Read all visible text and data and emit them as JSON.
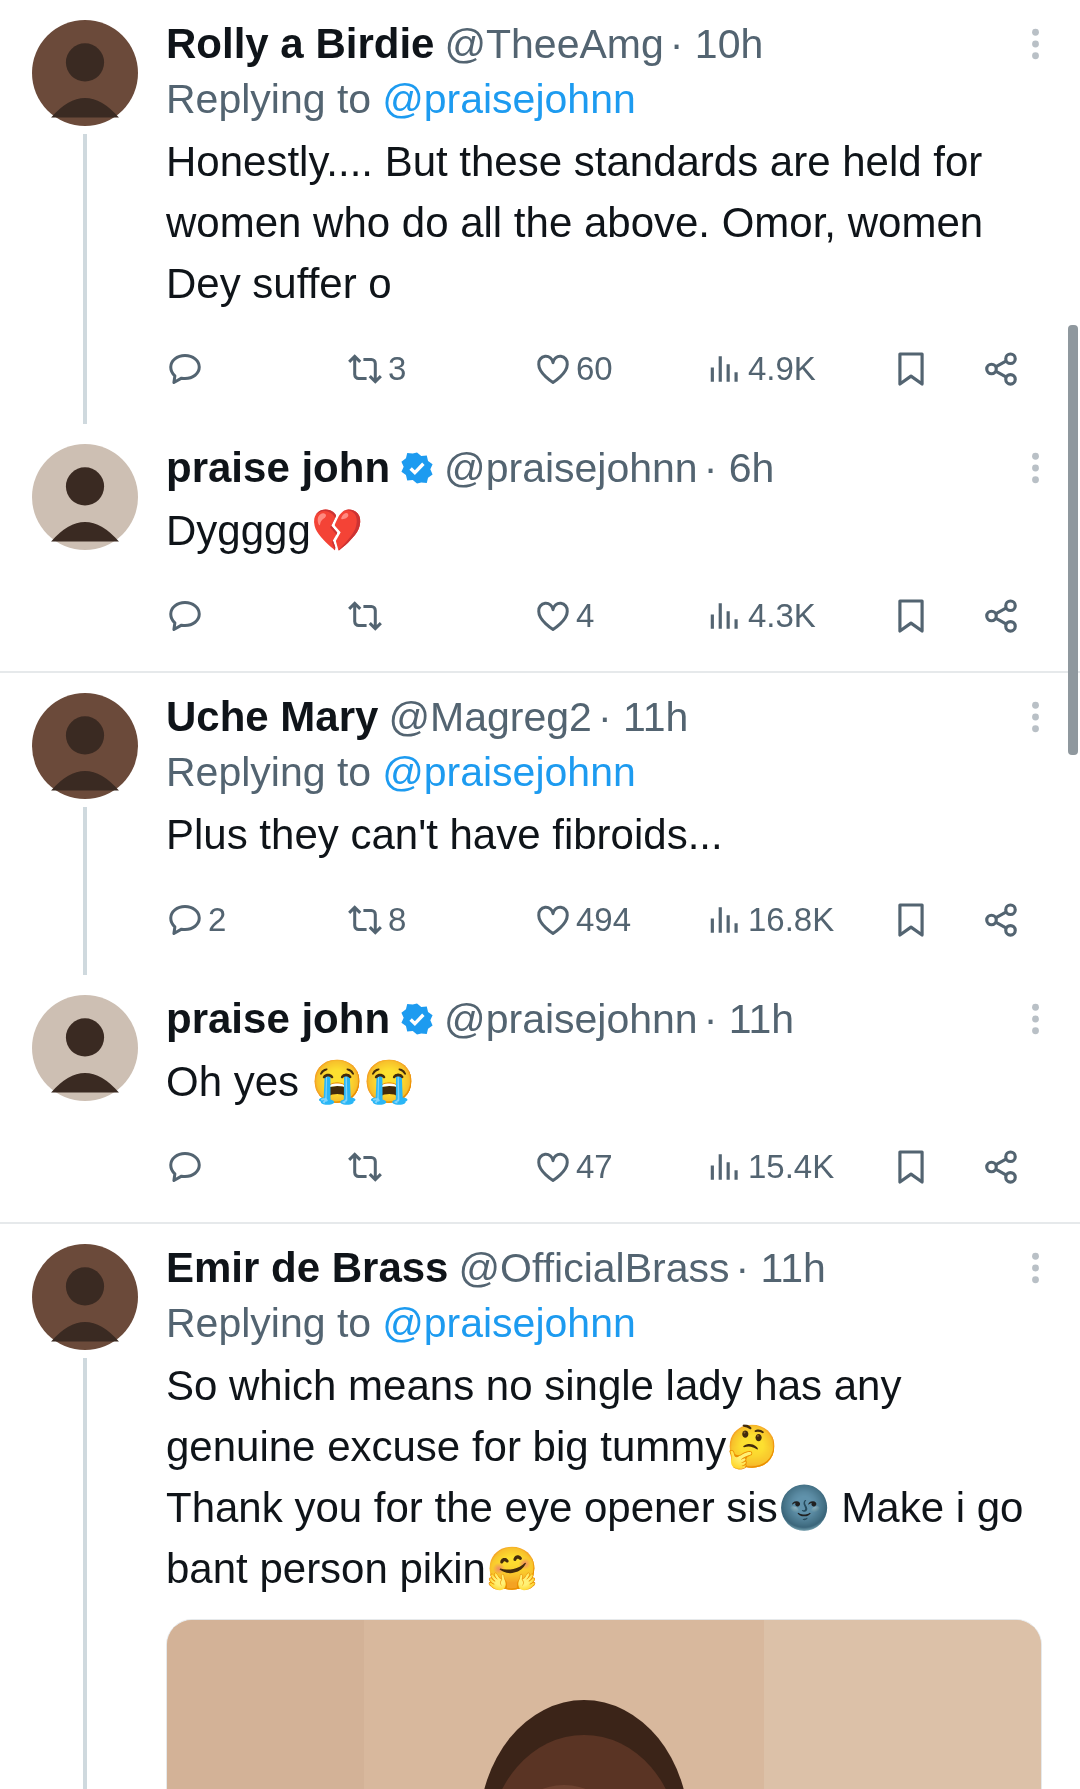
{
  "conversations": [
    {
      "tweets": [
        {
          "name": "Rolly a Birdie",
          "verified": false,
          "handle": "@TheeAmg",
          "time": "· 10h",
          "replying_label": "Replying to",
          "replying_to": "@praisejohnn",
          "text": "Honestly.... But these standards are held for women who do all the above. Omor, women Dey suffer o",
          "thread_line": true,
          "counts": {
            "retweets": "3",
            "likes": "60",
            "views": "4.9K"
          }
        },
        {
          "name": "praise john",
          "verified": true,
          "handle": "@praisejohnn",
          "time": "· 6h",
          "text": "Dygggg💔",
          "thread_line": false,
          "counts": {
            "likes": "4",
            "views": "4.3K"
          }
        }
      ]
    },
    {
      "tweets": [
        {
          "name": "Uche Mary",
          "verified": false,
          "handle": "@Magreg2",
          "time": "· 11h",
          "replying_label": "Replying to",
          "replying_to": "@praisejohnn",
          "text": "Plus they can't have fibroids...",
          "thread_line": true,
          "counts": {
            "replies": "2",
            "retweets": "8",
            "likes": "494",
            "views": "16.8K"
          }
        },
        {
          "name": "praise john",
          "verified": true,
          "handle": "@praisejohnn",
          "time": "· 11h",
          "text": "Oh yes 😭😭",
          "thread_line": false,
          "counts": {
            "likes": "47",
            "views": "15.4K"
          }
        }
      ]
    },
    {
      "tweets": [
        {
          "name": "Emir de Brass",
          "verified": false,
          "handle": "@OfficialBrass",
          "time": "· 11h",
          "replying_label": "Replying to",
          "replying_to": "@praisejohnn",
          "text": "So which means no single lady has any genuine excuse for big tummy🤔\nThank you for the eye opener sis🌚 Make i go bant person pikin🤗",
          "thread_line": true
        }
      ]
    }
  ]
}
